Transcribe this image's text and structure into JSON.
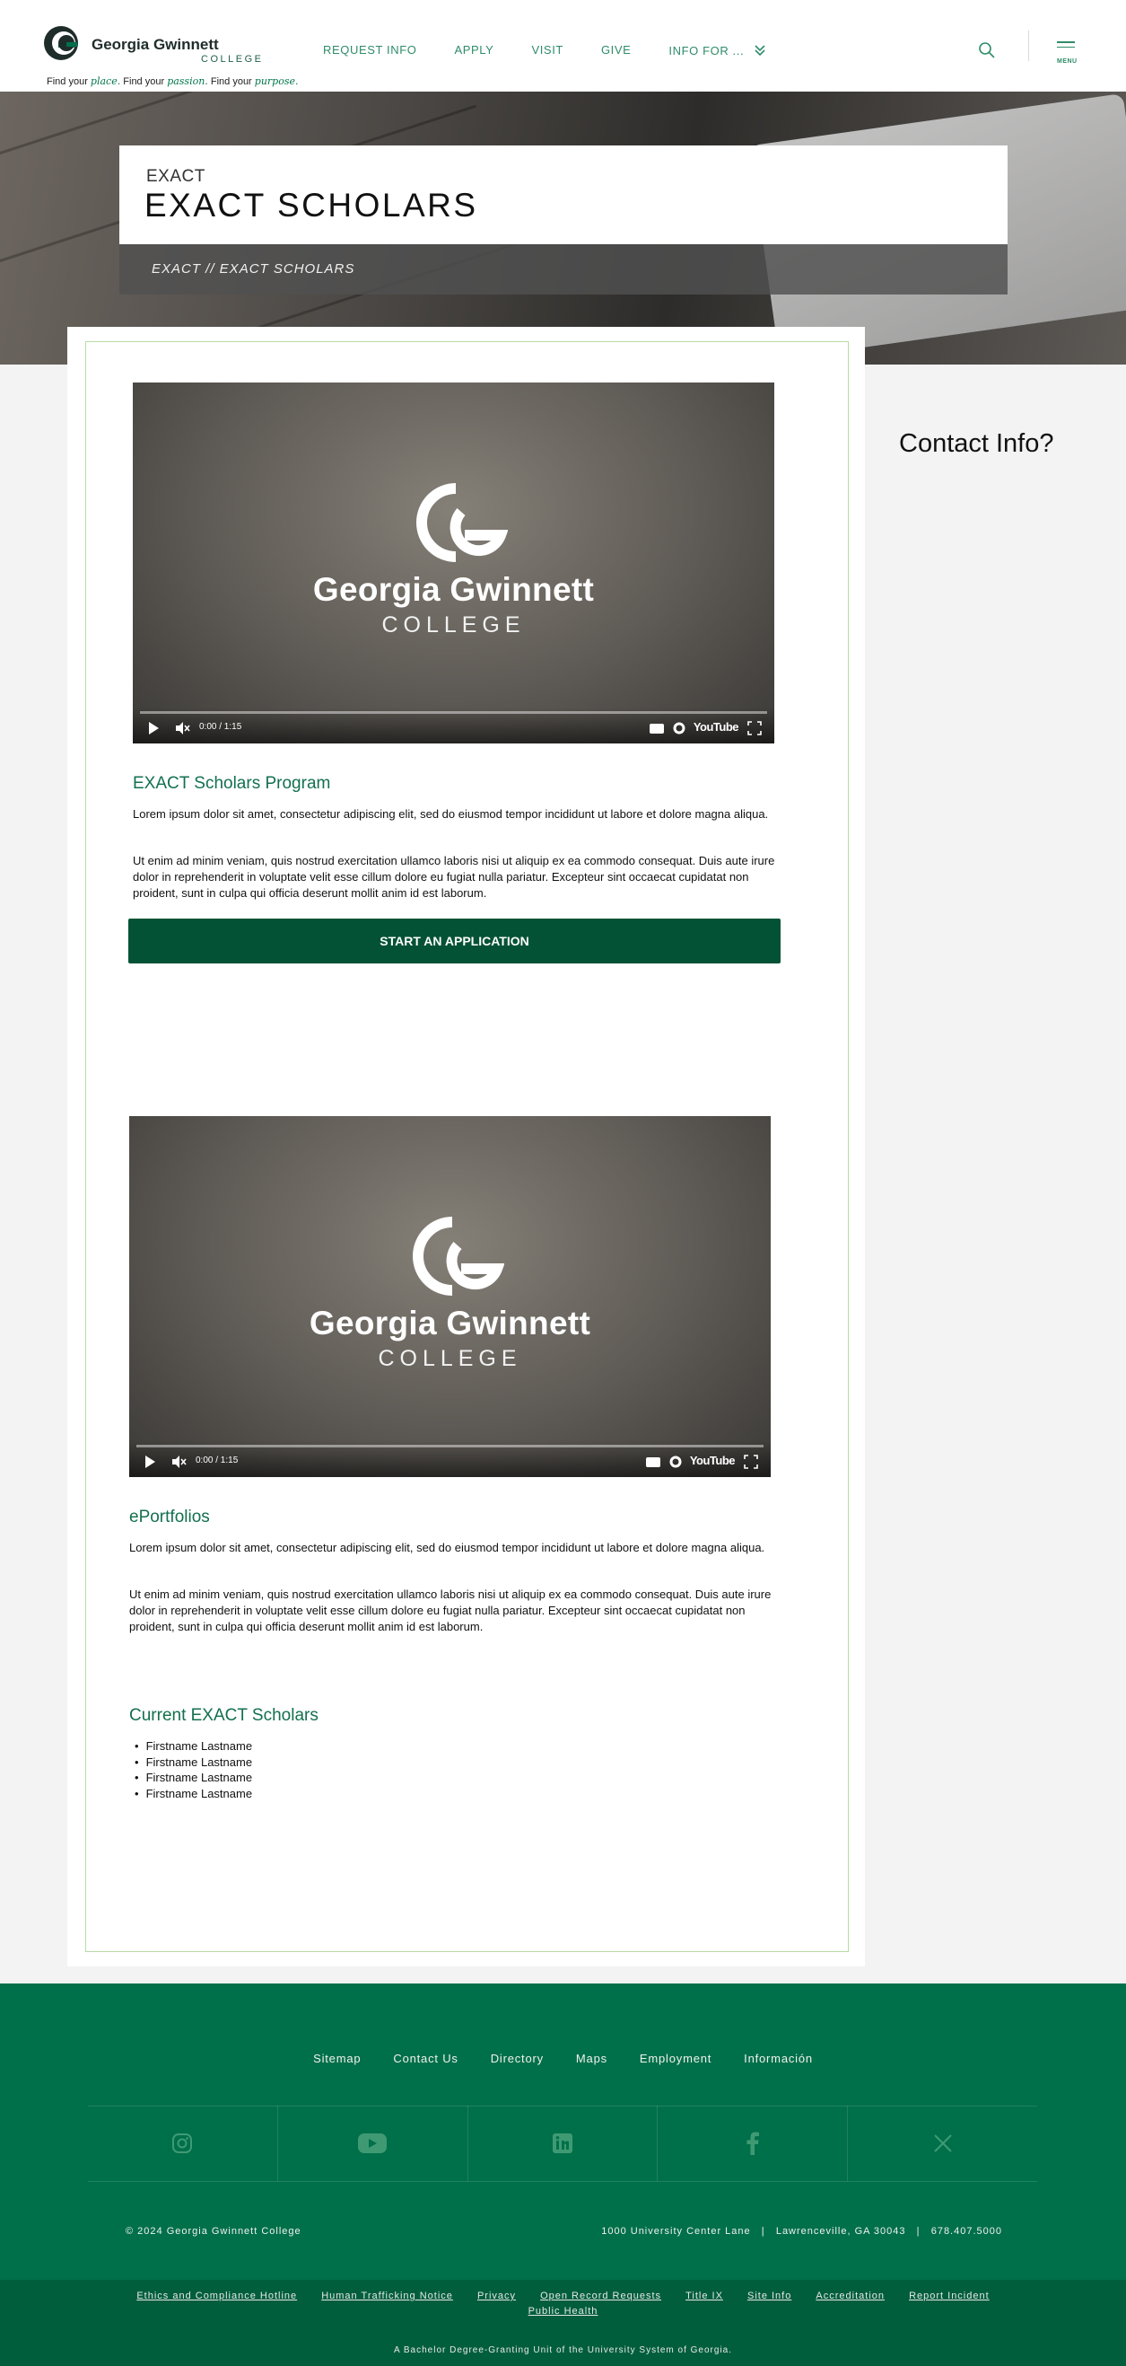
{
  "header": {
    "logo_name": "Georgia Gwinnett",
    "logo_sub": "COLLEGE",
    "tagline": [
      "Find your ",
      "place.",
      " Find your ",
      "passion.",
      " Find your ",
      "purpose."
    ],
    "nav": [
      "REQUEST INFO",
      "APPLY",
      "VISIT",
      "GIVE",
      "INFO FOR ..."
    ],
    "menu_label": "MENU",
    "icons": {
      "search": "search-icon",
      "menu": "hamburger-icon",
      "more": "chevron-double-down-icon"
    },
    "accent_color": "#2f8c6a"
  },
  "hero": {
    "eyebrow": "EXACT",
    "title": "EXACT SCHOLARS",
    "breadcrumb": "EXACT // EXACT SCHOLARS"
  },
  "videos": [
    {
      "brand": "Georgia Gwinnett",
      "college": "COLLEGE",
      "time": "0:00 / 1:15",
      "platform": "YouTube"
    },
    {
      "brand": "Georgia Gwinnett",
      "college": "COLLEGE",
      "time": "0:00 / 1:15",
      "platform": "YouTube"
    }
  ],
  "sections": {
    "program": {
      "title": "EXACT Scholars Program",
      "p1": "Lorem ipsum dolor sit amet, consectetur adipiscing elit, sed do eiusmod tempor incididunt ut labore et dolore magna aliqua.",
      "p2": "Ut enim ad minim veniam, quis nostrud exercitation ullamco laboris nisi ut aliquip ex ea commodo consequat. Duis aute irure dolor in reprehenderit in voluptate velit esse cillum dolore eu fugiat nulla pariatur. Excepteur sint occaecat cupidatat non proident, sunt in culpa qui officia deserunt mollit anim id est laborum.",
      "cta": "START AN APPLICATION"
    },
    "eportfolios": {
      "title": "ePortfolios",
      "p1": "Lorem ipsum dolor sit amet, consectetur adipiscing elit, sed do eiusmod tempor incididunt ut labore et dolore magna aliqua.",
      "p2": "Ut enim ad minim veniam, quis nostrud exercitation ullamco laboris nisi ut aliquip ex ea commodo consequat. Duis aute irure dolor in reprehenderit in voluptate velit esse cillum dolore eu fugiat nulla pariatur. Excepteur sint occaecat cupidatat non proident, sunt in culpa qui officia deserunt mollit anim id est laborum."
    },
    "current": {
      "title": "Current EXACT Scholars",
      "names": [
        "Firstname Lastname",
        "Firstname Lastname",
        "Firstname Lastname",
        "Firstname Lastname"
      ]
    }
  },
  "sidebar": {
    "contact_title": "Contact Info?"
  },
  "footer": {
    "links": [
      "Sitemap",
      "Contact Us",
      "Directory",
      "Maps",
      "Employment",
      "Información"
    ],
    "social": [
      "instagram-icon",
      "youtube-icon",
      "linkedin-icon",
      "facebook-icon",
      "x-icon"
    ],
    "copyright": "© 2024 Georgia Gwinnett College",
    "address": "1000 University Center Lane   |   Lawrenceville, GA 30043   |   678.407.5000",
    "legal_links": [
      "Ethics and Compliance Hotline",
      "Human Trafficking Notice",
      "Privacy",
      "Open Record Requests",
      "Title IX",
      "Site Info",
      "Accreditation",
      "Report Incident",
      "Public Health"
    ],
    "usg": "A Bachelor Degree-Granting Unit of the University System of Georgia.",
    "colors": {
      "footer": "#00704a",
      "legal": "#005e3d",
      "cta": "#045236"
    }
  }
}
